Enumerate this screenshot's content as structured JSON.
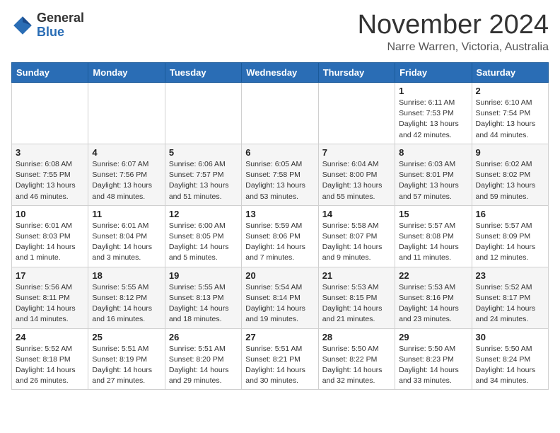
{
  "logo": {
    "general": "General",
    "blue": "Blue"
  },
  "header": {
    "month": "November 2024",
    "location": "Narre Warren, Victoria, Australia"
  },
  "weekdays": [
    "Sunday",
    "Monday",
    "Tuesday",
    "Wednesday",
    "Thursday",
    "Friday",
    "Saturday"
  ],
  "weeks": [
    [
      {
        "day": "",
        "info": ""
      },
      {
        "day": "",
        "info": ""
      },
      {
        "day": "",
        "info": ""
      },
      {
        "day": "",
        "info": ""
      },
      {
        "day": "",
        "info": ""
      },
      {
        "day": "1",
        "info": "Sunrise: 6:11 AM\nSunset: 7:53 PM\nDaylight: 13 hours\nand 42 minutes."
      },
      {
        "day": "2",
        "info": "Sunrise: 6:10 AM\nSunset: 7:54 PM\nDaylight: 13 hours\nand 44 minutes."
      }
    ],
    [
      {
        "day": "3",
        "info": "Sunrise: 6:08 AM\nSunset: 7:55 PM\nDaylight: 13 hours\nand 46 minutes."
      },
      {
        "day": "4",
        "info": "Sunrise: 6:07 AM\nSunset: 7:56 PM\nDaylight: 13 hours\nand 48 minutes."
      },
      {
        "day": "5",
        "info": "Sunrise: 6:06 AM\nSunset: 7:57 PM\nDaylight: 13 hours\nand 51 minutes."
      },
      {
        "day": "6",
        "info": "Sunrise: 6:05 AM\nSunset: 7:58 PM\nDaylight: 13 hours\nand 53 minutes."
      },
      {
        "day": "7",
        "info": "Sunrise: 6:04 AM\nSunset: 8:00 PM\nDaylight: 13 hours\nand 55 minutes."
      },
      {
        "day": "8",
        "info": "Sunrise: 6:03 AM\nSunset: 8:01 PM\nDaylight: 13 hours\nand 57 minutes."
      },
      {
        "day": "9",
        "info": "Sunrise: 6:02 AM\nSunset: 8:02 PM\nDaylight: 13 hours\nand 59 minutes."
      }
    ],
    [
      {
        "day": "10",
        "info": "Sunrise: 6:01 AM\nSunset: 8:03 PM\nDaylight: 14 hours\nand 1 minute."
      },
      {
        "day": "11",
        "info": "Sunrise: 6:01 AM\nSunset: 8:04 PM\nDaylight: 14 hours\nand 3 minutes."
      },
      {
        "day": "12",
        "info": "Sunrise: 6:00 AM\nSunset: 8:05 PM\nDaylight: 14 hours\nand 5 minutes."
      },
      {
        "day": "13",
        "info": "Sunrise: 5:59 AM\nSunset: 8:06 PM\nDaylight: 14 hours\nand 7 minutes."
      },
      {
        "day": "14",
        "info": "Sunrise: 5:58 AM\nSunset: 8:07 PM\nDaylight: 14 hours\nand 9 minutes."
      },
      {
        "day": "15",
        "info": "Sunrise: 5:57 AM\nSunset: 8:08 PM\nDaylight: 14 hours\nand 11 minutes."
      },
      {
        "day": "16",
        "info": "Sunrise: 5:57 AM\nSunset: 8:09 PM\nDaylight: 14 hours\nand 12 minutes."
      }
    ],
    [
      {
        "day": "17",
        "info": "Sunrise: 5:56 AM\nSunset: 8:11 PM\nDaylight: 14 hours\nand 14 minutes."
      },
      {
        "day": "18",
        "info": "Sunrise: 5:55 AM\nSunset: 8:12 PM\nDaylight: 14 hours\nand 16 minutes."
      },
      {
        "day": "19",
        "info": "Sunrise: 5:55 AM\nSunset: 8:13 PM\nDaylight: 14 hours\nand 18 minutes."
      },
      {
        "day": "20",
        "info": "Sunrise: 5:54 AM\nSunset: 8:14 PM\nDaylight: 14 hours\nand 19 minutes."
      },
      {
        "day": "21",
        "info": "Sunrise: 5:53 AM\nSunset: 8:15 PM\nDaylight: 14 hours\nand 21 minutes."
      },
      {
        "day": "22",
        "info": "Sunrise: 5:53 AM\nSunset: 8:16 PM\nDaylight: 14 hours\nand 23 minutes."
      },
      {
        "day": "23",
        "info": "Sunrise: 5:52 AM\nSunset: 8:17 PM\nDaylight: 14 hours\nand 24 minutes."
      }
    ],
    [
      {
        "day": "24",
        "info": "Sunrise: 5:52 AM\nSunset: 8:18 PM\nDaylight: 14 hours\nand 26 minutes."
      },
      {
        "day": "25",
        "info": "Sunrise: 5:51 AM\nSunset: 8:19 PM\nDaylight: 14 hours\nand 27 minutes."
      },
      {
        "day": "26",
        "info": "Sunrise: 5:51 AM\nSunset: 8:20 PM\nDaylight: 14 hours\nand 29 minutes."
      },
      {
        "day": "27",
        "info": "Sunrise: 5:51 AM\nSunset: 8:21 PM\nDaylight: 14 hours\nand 30 minutes."
      },
      {
        "day": "28",
        "info": "Sunrise: 5:50 AM\nSunset: 8:22 PM\nDaylight: 14 hours\nand 32 minutes."
      },
      {
        "day": "29",
        "info": "Sunrise: 5:50 AM\nSunset: 8:23 PM\nDaylight: 14 hours\nand 33 minutes."
      },
      {
        "day": "30",
        "info": "Sunrise: 5:50 AM\nSunset: 8:24 PM\nDaylight: 14 hours\nand 34 minutes."
      }
    ]
  ]
}
